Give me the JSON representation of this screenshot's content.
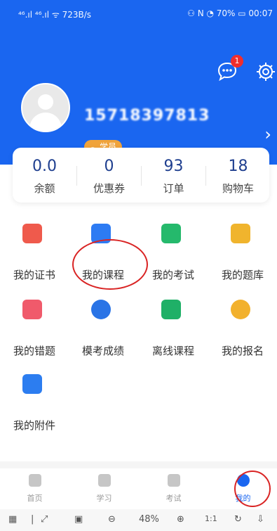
{
  "status_bar": {
    "left": "⁴⁶.ıl ⁴⁶.ıl ᯤ 723B/s",
    "right": "⚇ N ◔ 70% ▭ 00:07"
  },
  "header": {
    "phone": "15718397813",
    "role": "学员",
    "notification_count": "1"
  },
  "stats": [
    {
      "value": "0.0",
      "label": "余额"
    },
    {
      "value": "0",
      "label": "优惠券"
    },
    {
      "value": "93",
      "label": "订单"
    },
    {
      "value": "18",
      "label": "购物车"
    }
  ],
  "grid_items": [
    {
      "label": "我的证书",
      "color": "#ef5a4c",
      "icon": "certificate-icon"
    },
    {
      "label": "我的课程",
      "color": "#2d7bf3",
      "icon": "course-icon"
    },
    {
      "label": "我的考试",
      "color": "#25b96c",
      "icon": "exam-icon"
    },
    {
      "label": "我的题库",
      "color": "#f0b42d",
      "icon": "question-bank-icon"
    },
    {
      "label": "我的错题",
      "color": "#f05a6b",
      "icon": "wrong-questions-icon"
    },
    {
      "label": "模考成绩",
      "color": "#2a74e6",
      "icon": "mock-score-icon"
    },
    {
      "label": "离线课程",
      "color": "#1fb067",
      "icon": "offline-course-icon"
    },
    {
      "label": "我的报名",
      "color": "#f2b12d",
      "icon": "registration-icon"
    },
    {
      "label": "我的附件",
      "color": "#2c7df0",
      "icon": "attachment-icon"
    }
  ],
  "tabs": [
    {
      "label": "首页"
    },
    {
      "label": "学习"
    },
    {
      "label": "考试"
    },
    {
      "label": "我的"
    }
  ],
  "toolbar": {
    "zoom": "48%",
    "one_to_one": "1:1"
  },
  "colors": {
    "primary": "#1a66f0",
    "annotation_red": "#d92424"
  }
}
